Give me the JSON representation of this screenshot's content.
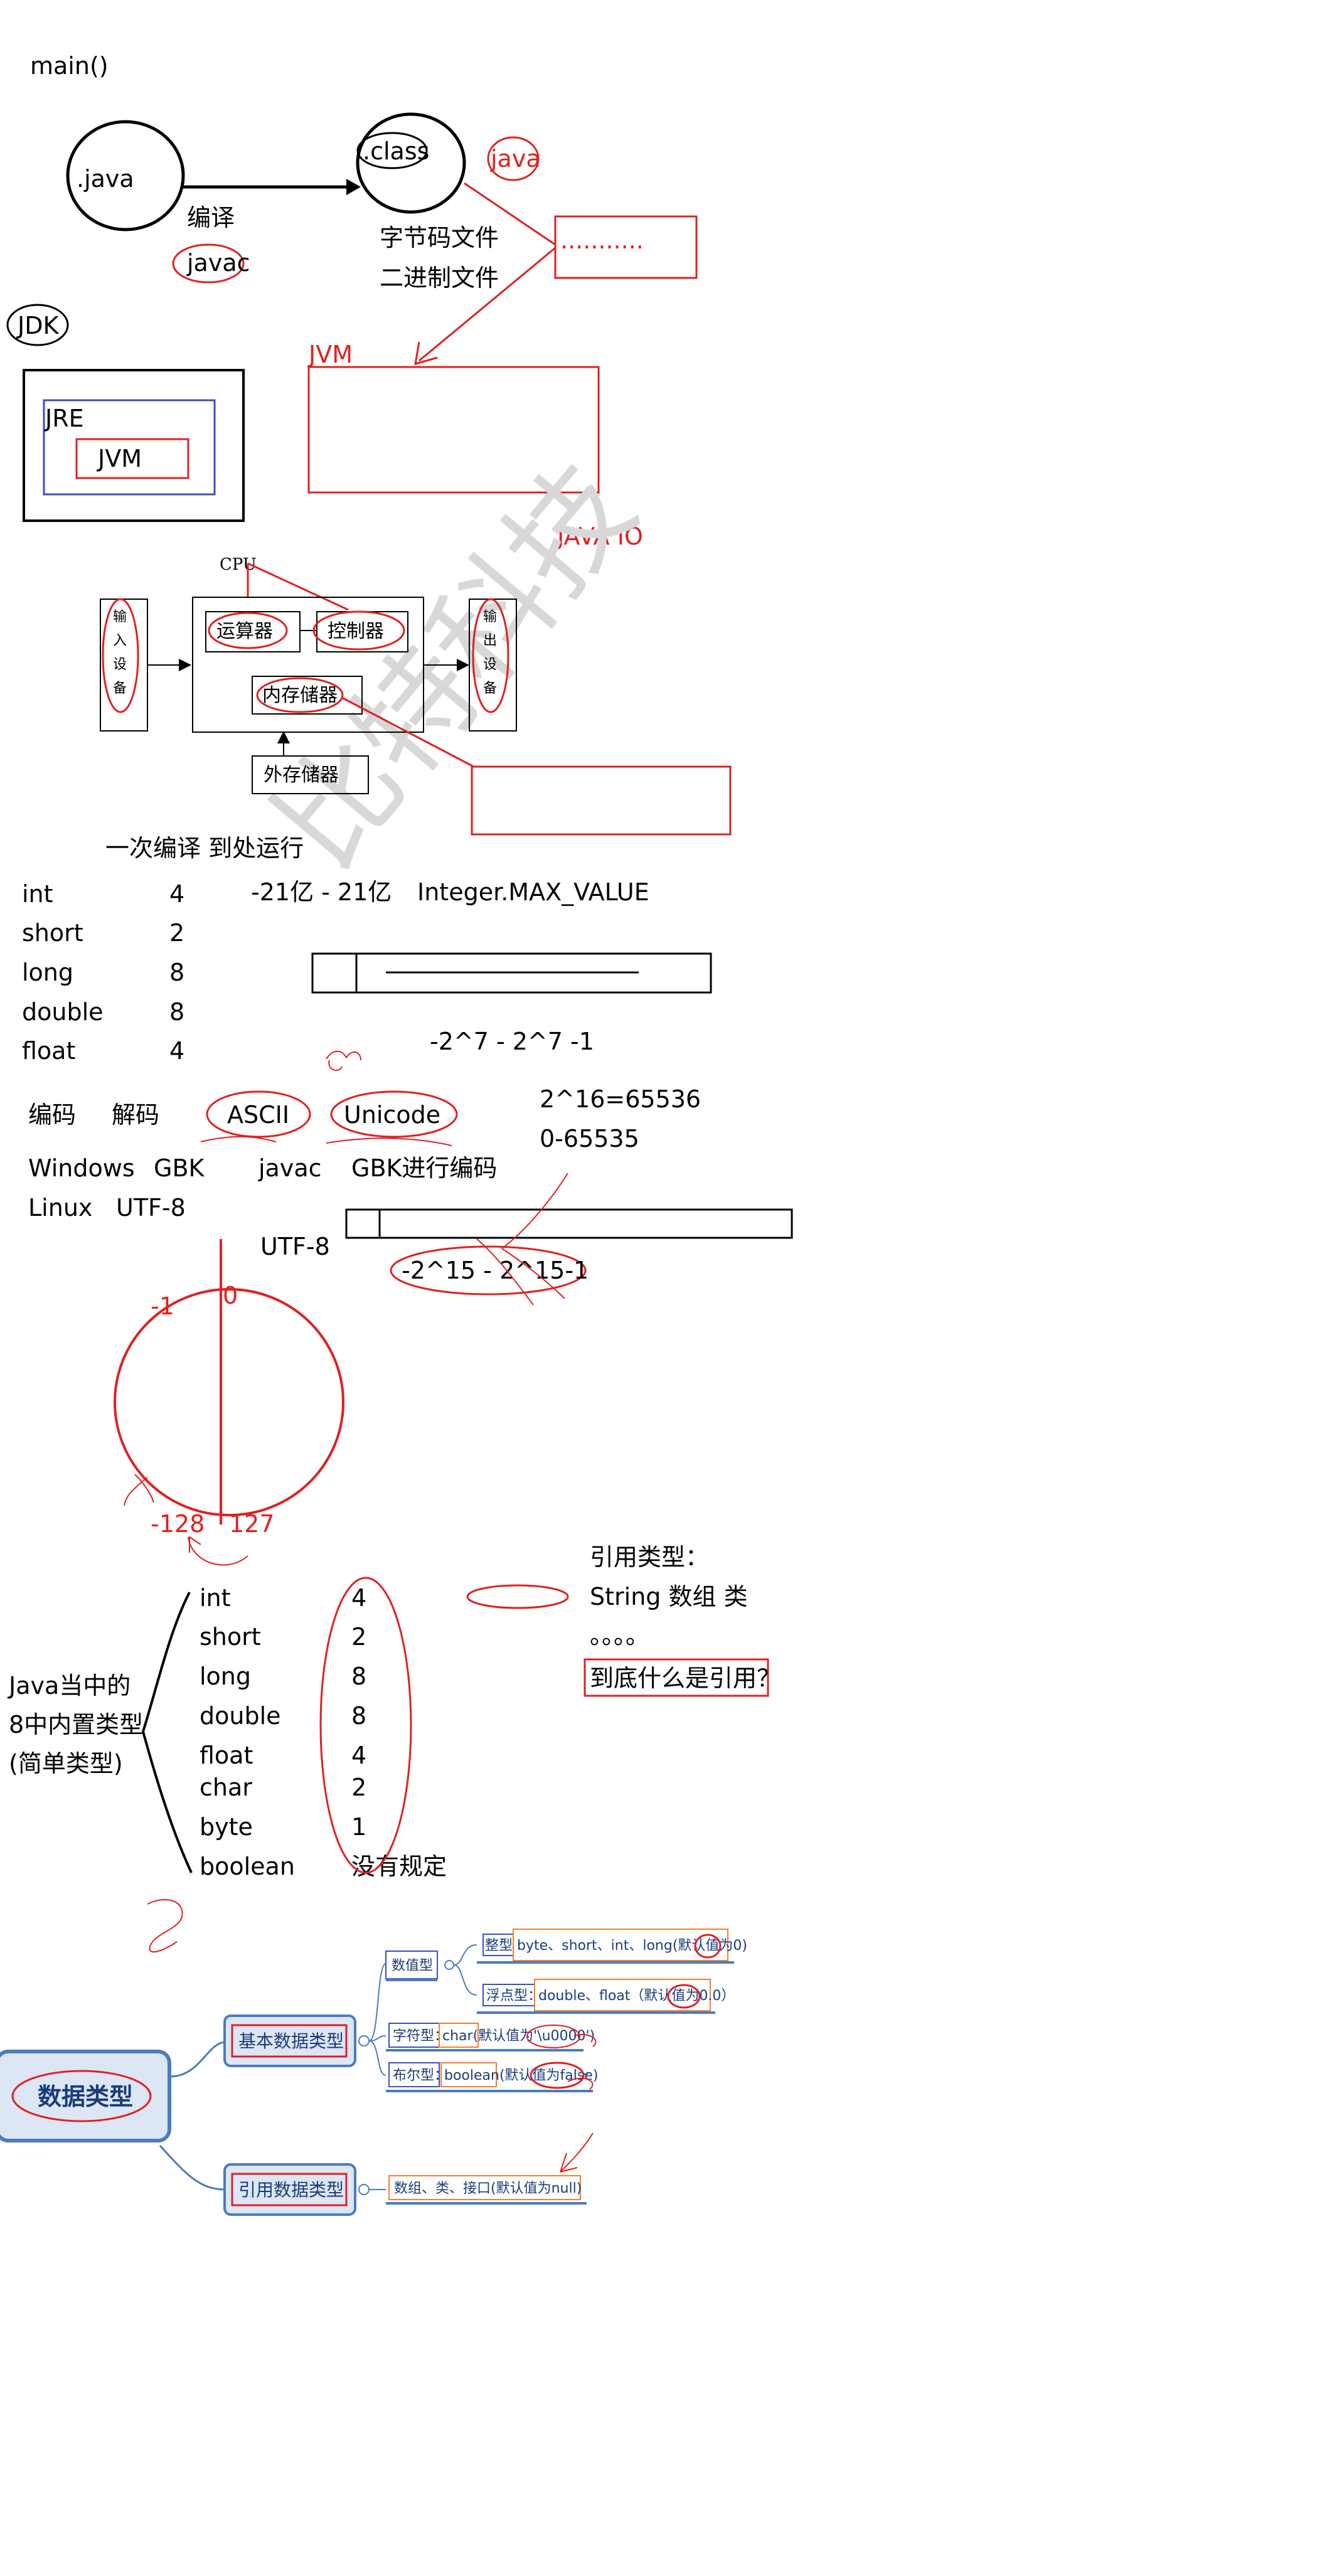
{
  "colors": {
    "ink": "#000000",
    "red": "#e02020",
    "blue": "#3a4fc0",
    "mindmap_fill": "#dce6f5",
    "mindmap_border": "#4a7cc0",
    "orange": "#f08030"
  },
  "compile": {
    "main_label": "main()",
    "java_node": ".java",
    "class_node": ".class",
    "compile_label": "编译",
    "javac_label": "javac",
    "bytecode_label": "字节码文件",
    "binary_label": "二进制文件",
    "java_cmd": "java",
    "dots": "...........",
    "jvm_red": "JVM",
    "jdk": "JDK",
    "jre": "JRE",
    "jvm_inner": "JVM",
    "java_io": "JAVA IO"
  },
  "computer": {
    "cpu": "CPU",
    "input": [
      "输",
      "入",
      "设",
      "备"
    ],
    "output": [
      "输",
      "出",
      "设",
      "备"
    ],
    "alu": "运算器",
    "controller": "控制器",
    "memory": "内存储器",
    "storage": "外存储器",
    "watermark": "比特科技",
    "slogan": "一次编译 到处运行"
  },
  "sizes": {
    "types": [
      {
        "name": "int",
        "size": "4"
      },
      {
        "name": "short",
        "size": "2"
      },
      {
        "name": "long",
        "size": "8"
      },
      {
        "name": "double",
        "size": "8"
      },
      {
        "name": "float",
        "size": "4"
      }
    ],
    "int_range": "-21亿 - 21亿",
    "int_max": "Integer.MAX_VALUE",
    "byte_range": "-2^7  - 2^7  -1"
  },
  "encoding": {
    "encode": "编码",
    "decode": "解码",
    "ascii": "ASCII",
    "unicode": "Unicode",
    "pow": "2^16=65536",
    "range": "0-65535",
    "windows": "Windows",
    "gbk": "GBK",
    "javac": "javac",
    "gbk_encode": "GBK进行编码",
    "linux": "Linux",
    "utf8_a": "UTF-8",
    "utf8_b": "UTF-8",
    "short_range": "-2^15 - 2^15-1"
  },
  "circle": {
    "neg1": "-1",
    "zero": "0",
    "min": "-128",
    "max": "127"
  },
  "builtin": {
    "caption": [
      "Java当中的",
      "8中内置类型",
      "(简单类型)"
    ],
    "types": [
      {
        "name": "int",
        "size": "4"
      },
      {
        "name": "short",
        "size": "2"
      },
      {
        "name": "long",
        "size": "8"
      },
      {
        "name": "double",
        "size": "8"
      },
      {
        "name": "float",
        "size": "4"
      },
      {
        "name": "char",
        "size": "2"
      },
      {
        "name": "byte",
        "size": "1"
      },
      {
        "name": "boolean",
        "size": "没有规定"
      }
    ],
    "ref_title": "引用类型：",
    "ref_items": "String  数组  类",
    "ref_dots": "。。。。",
    "ref_question": "到底什么是引用？"
  },
  "mindmap": {
    "root": "数据类型",
    "basic": "基本数据类型",
    "reference": "引用数据类型",
    "numeric": "数值型",
    "integer_label": "整型：",
    "integer_value": "byte、short、int、long(默认值为0)",
    "float_label": "浮点型：",
    "float_value": "double、float（默认值为0.0）",
    "char_label": "字符型：",
    "char_value": "char(默认值为'\\u0000')",
    "bool_label": "布尔型：",
    "bool_value": "boolean(默认值为false)",
    "ref_value": "数组、类、接口(默认值为null)",
    "bool_collapse": "-"
  }
}
